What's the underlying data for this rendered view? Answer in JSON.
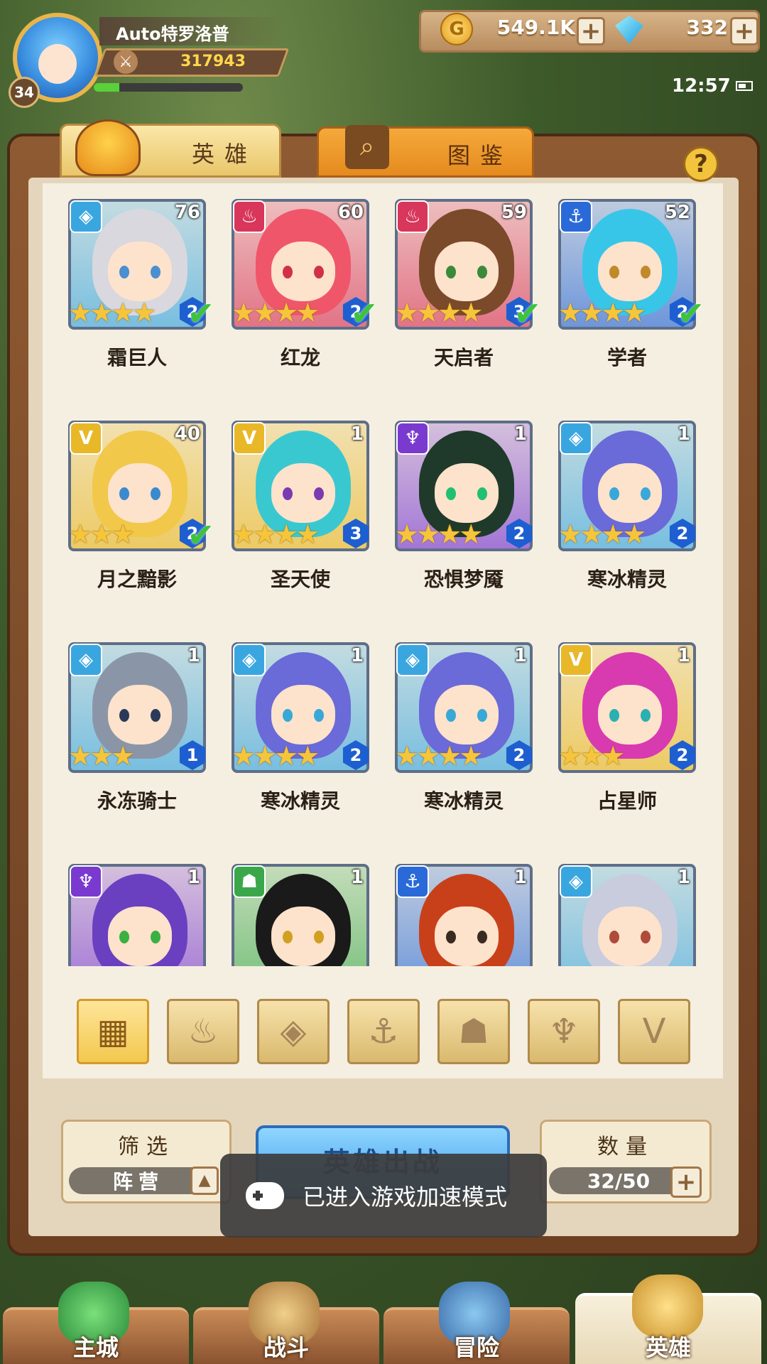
{
  "player": {
    "name": "Auto特罗洛普",
    "level": "34",
    "power": "317943",
    "xp_fraction": 0.17
  },
  "resources": {
    "gold": "549.1K",
    "gems": "332"
  },
  "clock": "12:57",
  "tabs": [
    {
      "label": "英雄"
    },
    {
      "label": "图鉴"
    }
  ],
  "heroes": [
    {
      "name": "霜巨人",
      "level": "76",
      "stars": 4,
      "rank": "2",
      "checked": true,
      "class": "ice",
      "hair": "#d8d8de",
      "eye": "#4a8fd0"
    },
    {
      "name": "红龙",
      "level": "60",
      "stars": 4,
      "rank": "2",
      "checked": true,
      "class": "fire",
      "hair": "#f0566a",
      "eye": "#d0304a"
    },
    {
      "name": "天启者",
      "level": "59",
      "stars": 4,
      "rank": "3",
      "checked": true,
      "class": "fire",
      "hair": "#7a4a2a",
      "eye": "#3a8a3a"
    },
    {
      "name": "学者",
      "level": "52",
      "stars": 4,
      "rank": "2",
      "checked": true,
      "class": "anchor",
      "hair": "#38c6e8",
      "eye": "#c08a2a"
    },
    {
      "name": "月之黯影",
      "level": "40",
      "stars": 3,
      "rank": "2",
      "checked": true,
      "class": "light",
      "hair": "#f2c84a",
      "eye": "#3a8ad0"
    },
    {
      "name": "圣天使",
      "level": "1",
      "stars": 4,
      "rank": "3",
      "checked": false,
      "class": "light",
      "hair": "#3ac8d0",
      "eye": "#7a3ab0"
    },
    {
      "name": "恐惧梦魇",
      "level": "1",
      "stars": 4,
      "rank": "2",
      "checked": false,
      "class": "dark",
      "hair": "#1f3a2a",
      "eye": "#20c070"
    },
    {
      "name": "寒冰精灵",
      "level": "1",
      "stars": 4,
      "rank": "2",
      "checked": false,
      "class": "ice",
      "hair": "#6a6ad8",
      "eye": "#38a8d8"
    },
    {
      "name": "永冻骑士",
      "level": "1",
      "stars": 3,
      "rank": "1",
      "checked": false,
      "class": "ice",
      "hair": "#8a96a8",
      "eye": "#2a3a58"
    },
    {
      "name": "寒冰精灵",
      "level": "1",
      "stars": 4,
      "rank": "2",
      "checked": false,
      "class": "ice",
      "hair": "#6a6ad8",
      "eye": "#38a8d8"
    },
    {
      "name": "寒冰精灵",
      "level": "1",
      "stars": 4,
      "rank": "2",
      "checked": false,
      "class": "ice",
      "hair": "#6a6ad8",
      "eye": "#38a8d8"
    },
    {
      "name": "占星师",
      "level": "1",
      "stars": 3,
      "rank": "2",
      "checked": false,
      "class": "light",
      "hair": "#d83ab0",
      "eye": "#2ab0b0"
    },
    {
      "name": "",
      "level": "1",
      "stars": 0,
      "rank": "",
      "checked": false,
      "class": "dark",
      "hair": "#6a40c0",
      "eye": "#3ab040"
    },
    {
      "name": "",
      "level": "1",
      "stars": 0,
      "rank": "",
      "checked": false,
      "class": "beast",
      "hair": "#1a1a1a",
      "eye": "#d0a020"
    },
    {
      "name": "",
      "level": "1",
      "stars": 0,
      "rank": "",
      "checked": false,
      "class": "anchor",
      "hair": "#c8401a",
      "eye": "#3a2a20"
    },
    {
      "name": "",
      "level": "1",
      "stars": 0,
      "rank": "",
      "checked": false,
      "class": "ice",
      "hair": "#c8ccdc",
      "eye": "#b04a3a"
    }
  ],
  "class_colors": {
    "ice": "#3aa6e0",
    "fire": "#d8365a",
    "anchor": "#2a6ad8",
    "light": "#e8b828",
    "dark": "#7a3ad0",
    "beast": "#3aa84a"
  },
  "class_icons": {
    "ice": "◈",
    "fire": "♨",
    "anchor": "⚓",
    "light": "V",
    "dark": "♆",
    "beast": "☗"
  },
  "faction_filters": [
    {
      "icon": "all-grid",
      "glyph": "▦",
      "selected": true
    },
    {
      "icon": "fire",
      "glyph": "♨",
      "selected": false
    },
    {
      "icon": "ice",
      "glyph": "◈",
      "selected": false
    },
    {
      "icon": "anchor",
      "glyph": "⚓",
      "selected": false
    },
    {
      "icon": "beast",
      "glyph": "☗",
      "selected": false
    },
    {
      "icon": "dark",
      "glyph": "♆",
      "selected": false
    },
    {
      "icon": "light",
      "glyph": "V",
      "selected": false
    }
  ],
  "filter_panel": {
    "title": "筛选",
    "value": "阵营"
  },
  "deploy_button": "英雄出战",
  "count_panel": {
    "title": "数量",
    "value": "32/50"
  },
  "toast": "已进入游戏加速模式",
  "nav": [
    {
      "label": "主城"
    },
    {
      "label": "战斗"
    },
    {
      "label": "冒险"
    },
    {
      "label": "英雄"
    }
  ]
}
